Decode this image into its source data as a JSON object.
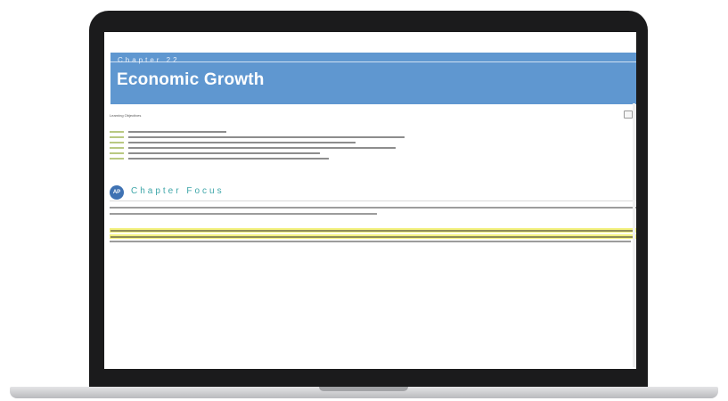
{
  "header": {
    "chapter_label": "Chapter 22",
    "title": "Economic Growth"
  },
  "learning_objectives": {
    "heading": "Learning Objectives",
    "item_count": 6
  },
  "focus": {
    "badge": "AP",
    "title": "Chapter Focus"
  },
  "colors": {
    "banner": "#5f97d0",
    "focus_title": "#3ea6a9",
    "highlight": "#f2f07e",
    "laptop_bezel": "#1b1b1c"
  }
}
